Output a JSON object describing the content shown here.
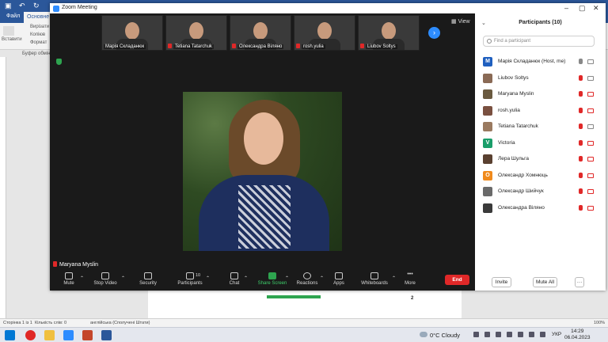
{
  "word": {
    "tabs": [
      "Файл",
      "Основне"
    ],
    "clipboard": {
      "paste": "Вставити",
      "cut": "Вирізати",
      "copy": "Копіюв",
      "format": "Формат",
      "group": "Буфер обміну"
    },
    "status": {
      "page": "Сторінка 1 із 1",
      "words": "Кількість слів: 0",
      "language": "англійська (Сполучені Штати)",
      "zoom": "100%"
    },
    "page_number": "2"
  },
  "zoom": {
    "title": "Zoom Meeting",
    "view_label": "View",
    "thumbnails": [
      {
        "name": "Марія Складанюк",
        "muted": false
      },
      {
        "name": "Tetiana Tatarchuk",
        "muted": true
      },
      {
        "name": "Олександра Віляно",
        "muted": true
      },
      {
        "name": "rosh.yulia",
        "muted": true
      },
      {
        "name": "Liubov Soltys",
        "muted": true
      }
    ],
    "active_speaker": "Maryana Myslin",
    "toolbar": {
      "mute": "Mute",
      "stop_video": "Stop Video",
      "security": "Security",
      "participants": "Participants",
      "participants_count": "10",
      "chat": "Chat",
      "share_screen": "Share Screen",
      "reactions": "Reactions",
      "apps": "Apps",
      "whiteboards": "Whiteboards",
      "more": "More",
      "end": "End"
    },
    "panel": {
      "title": "Participants (10)",
      "search_placeholder": "Find a participant",
      "invite": "Invite",
      "mute_all": "Mute All",
      "more": "···",
      "participants": [
        {
          "name": "Марія Складанюк (Host, me)",
          "initial": "M",
          "color": "#1f5fbf",
          "mic": "on",
          "cam": "on"
        },
        {
          "name": "Liubov Soltys",
          "initial": "",
          "color": "#8a6a55",
          "mic": "off",
          "cam": "on"
        },
        {
          "name": "Maryana Myslin",
          "initial": "",
          "color": "#6a5a40",
          "mic": "off",
          "cam": "off"
        },
        {
          "name": "rosh.yulia",
          "initial": "",
          "color": "#7a5040",
          "mic": "off",
          "cam": "off"
        },
        {
          "name": "Tetiana Tatarchuk",
          "initial": "",
          "color": "#9a7a60",
          "mic": "off",
          "cam": "on"
        },
        {
          "name": "Victoria",
          "initial": "V",
          "color": "#1a9e6a",
          "mic": "off",
          "cam": "off"
        },
        {
          "name": "Лера Шульга",
          "initial": "",
          "color": "#5a4030",
          "mic": "off",
          "cam": "off"
        },
        {
          "name": "Олександр Хомнюць",
          "initial": "О",
          "color": "#f08a1c",
          "mic": "off",
          "cam": "off"
        },
        {
          "name": "Олександр Шийчук",
          "initial": "",
          "color": "#6a6a6a",
          "mic": "off",
          "cam": "off"
        },
        {
          "name": "Олександра Віляно",
          "initial": "",
          "color": "#3a3a3a",
          "mic": "off",
          "cam": "off"
        }
      ]
    }
  },
  "taskbar": {
    "weather": "0°C  Cloudy",
    "language": "УКР",
    "time": "14:29",
    "date": "06.04.2023"
  }
}
